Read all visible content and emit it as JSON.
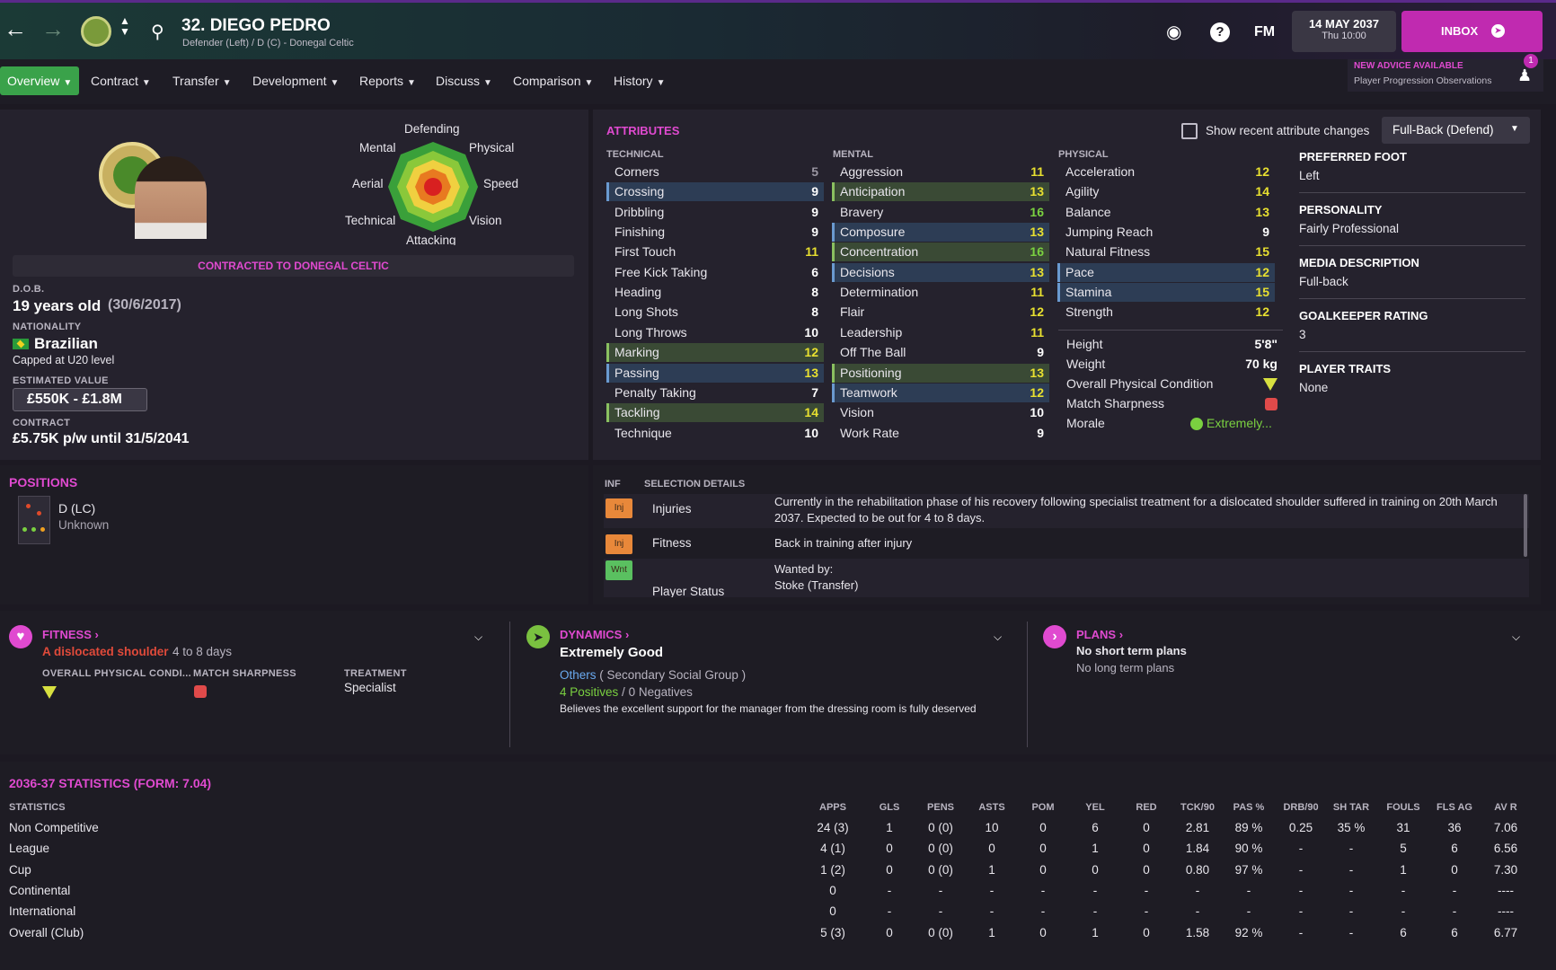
{
  "header": {
    "player_title": "32. DIEGO PEDRO",
    "player_subtitle": "Defender (Left) / D (C) - Donegal Celtic",
    "fm_label": "FM",
    "date": "14 MAY 2037",
    "time": "Thu 10:00",
    "inbox_label": "INBOX"
  },
  "nav": {
    "items": [
      "Overview",
      "Contract",
      "Transfer",
      "Development",
      "Reports",
      "Discuss",
      "Comparison",
      "History"
    ],
    "advice_title": "NEW ADVICE AVAILABLE",
    "advice_sub": "Player Progression Observations",
    "advice_count": "1"
  },
  "profile": {
    "radar_labels": {
      "top": "Defending",
      "tl": "Mental",
      "tr": "Physical",
      "l": "Aerial",
      "r": "Speed",
      "bl": "Technical",
      "br": "Vision",
      "b": "Attacking"
    },
    "contracted": "CONTRACTED TO DONEGAL CELTIC",
    "dob_label": "D.O.B.",
    "age": "19 years old",
    "dob": "(30/6/2017)",
    "nationality_label": "NATIONALITY",
    "nationality": "Brazilian",
    "capped": "Capped at U20 level",
    "value_label": "ESTIMATED VALUE",
    "value": "£550K - £1.8M",
    "contract_label": "CONTRACT",
    "contract": "£5.75K p/w until 31/5/2041"
  },
  "attributes": {
    "title": "ATTRIBUTES",
    "show_changes": "Show recent attribute changes",
    "role": "Full-Back (Defend)",
    "technical_header": "TECHNICAL",
    "mental_header": "MENTAL",
    "physical_header": "PHYSICAL",
    "technical": [
      {
        "name": "Corners",
        "value": "5"
      },
      {
        "name": "Crossing",
        "value": "9"
      },
      {
        "name": "Dribbling",
        "value": "9"
      },
      {
        "name": "Finishing",
        "value": "9"
      },
      {
        "name": "First Touch",
        "value": "11"
      },
      {
        "name": "Free Kick Taking",
        "value": "6"
      },
      {
        "name": "Heading",
        "value": "8"
      },
      {
        "name": "Long Shots",
        "value": "8"
      },
      {
        "name": "Long Throws",
        "value": "10"
      },
      {
        "name": "Marking",
        "value": "12"
      },
      {
        "name": "Passing",
        "value": "13"
      },
      {
        "name": "Penalty Taking",
        "value": "7"
      },
      {
        "name": "Tackling",
        "value": "14"
      },
      {
        "name": "Technique",
        "value": "10"
      }
    ],
    "mental": [
      {
        "name": "Aggression",
        "value": "11"
      },
      {
        "name": "Anticipation",
        "value": "13"
      },
      {
        "name": "Bravery",
        "value": "16"
      },
      {
        "name": "Composure",
        "value": "13"
      },
      {
        "name": "Concentration",
        "value": "16"
      },
      {
        "name": "Decisions",
        "value": "13"
      },
      {
        "name": "Determination",
        "value": "11"
      },
      {
        "name": "Flair",
        "value": "12"
      },
      {
        "name": "Leadership",
        "value": "11"
      },
      {
        "name": "Off The Ball",
        "value": "9"
      },
      {
        "name": "Positioning",
        "value": "13"
      },
      {
        "name": "Teamwork",
        "value": "12"
      },
      {
        "name": "Vision",
        "value": "10"
      },
      {
        "name": "Work Rate",
        "value": "9"
      }
    ],
    "physical": [
      {
        "name": "Acceleration",
        "value": "12"
      },
      {
        "name": "Agility",
        "value": "14"
      },
      {
        "name": "Balance",
        "value": "13"
      },
      {
        "name": "Jumping Reach",
        "value": "9"
      },
      {
        "name": "Natural Fitness",
        "value": "15"
      },
      {
        "name": "Pace",
        "value": "12"
      },
      {
        "name": "Stamina",
        "value": "15"
      },
      {
        "name": "Strength",
        "value": "12"
      }
    ],
    "height_label": "Height",
    "height": "5'8\"",
    "weight_label": "Weight",
    "weight": "70 kg",
    "condition_label": "Overall Physical Condition",
    "sharpness_label": "Match Sharpness",
    "morale_label": "Morale",
    "morale": "Extremely..."
  },
  "side": {
    "foot_label": "PREFERRED FOOT",
    "foot": "Left",
    "personality_label": "PERSONALITY",
    "personality": "Fairly Professional",
    "media_label": "MEDIA DESCRIPTION",
    "media": "Full-back",
    "gk_label": "GOALKEEPER RATING",
    "gk": "3",
    "traits_label": "PLAYER TRAITS",
    "traits": "None"
  },
  "positions": {
    "title": "POSITIONS",
    "pos": "D (LC)",
    "familiarity": "Unknown"
  },
  "selection": {
    "inf_header": "INF",
    "sel_header": "SELECTION DETAILS",
    "rows": [
      {
        "tag": "Inj",
        "label": "Injuries",
        "text": "Currently in the rehabilitation phase of his recovery following specialist treatment for a dislocated shoulder suffered in training on 20th March 2037. Expected to be out for 4 to 8 days."
      },
      {
        "tag": "Inj",
        "label": "Fitness",
        "text": "Back in training after injury"
      },
      {
        "tag": "Wnt",
        "label": "Player Status",
        "text1": "Wanted by:",
        "text2": "Stoke (Transfer)"
      }
    ]
  },
  "fitness": {
    "title": "FITNESS",
    "injury": "A dislocated shoulder",
    "duration": "4 to 8 days",
    "cond_label": "OVERALL PHYSICAL CONDI...",
    "sharp_label": "MATCH SHARPNESS",
    "treat_label": "TREATMENT",
    "treatment": "Specialist"
  },
  "dynamics": {
    "title": "DYNAMICS",
    "status": "Extremely Good",
    "group": "Others",
    "group_note": "( Secondary Social Group )",
    "positives": "4 Positives",
    "slash": "/",
    "negatives": "0 Negatives",
    "note": "Believes the excellent support for the manager from the dressing room is fully deserved"
  },
  "plans": {
    "title": "PLANS",
    "short": "No short term plans",
    "long": "No long term plans"
  },
  "stats": {
    "title": "2036-37 STATISTICS (FORM: 7.04)",
    "columns": [
      "STATISTICS",
      "APPS",
      "GLS",
      "PENS",
      "ASTS",
      "POM",
      "YEL",
      "RED",
      "TCK/90",
      "PAS %",
      "DRB/90",
      "SH TAR",
      "FOULS",
      "FLS AG",
      "AV R"
    ],
    "rows": [
      [
        "Non Competitive",
        "24 (3)",
        "1",
        "0 (0)",
        "10",
        "0",
        "6",
        "0",
        "2.81",
        "89 %",
        "0.25",
        "35 %",
        "31",
        "36",
        "7.06"
      ],
      [
        "League",
        "4 (1)",
        "0",
        "0 (0)",
        "0",
        "0",
        "1",
        "0",
        "1.84",
        "90 %",
        "-",
        "-",
        "5",
        "6",
        "6.56"
      ],
      [
        "Cup",
        "1 (2)",
        "0",
        "0 (0)",
        "1",
        "0",
        "0",
        "0",
        "0.80",
        "97 %",
        "-",
        "-",
        "1",
        "0",
        "7.30"
      ],
      [
        "Continental",
        "0",
        "-",
        "-",
        "-",
        "-",
        "-",
        "-",
        "-",
        "-",
        "-",
        "-",
        "-",
        "-",
        "----"
      ],
      [
        "International",
        "0",
        "-",
        "-",
        "-",
        "-",
        "-",
        "-",
        "-",
        "-",
        "-",
        "-",
        "-",
        "-",
        "----"
      ],
      [
        "Overall (Club)",
        "5 (3)",
        "0",
        "0 (0)",
        "1",
        "0",
        "1",
        "0",
        "1.58",
        "92 %",
        "-",
        "-",
        "6",
        "6",
        "6.77"
      ]
    ]
  },
  "colors": {
    "pink": "#e04ad0",
    "green": "#3aa24a",
    "yellow": "#e8e030"
  }
}
